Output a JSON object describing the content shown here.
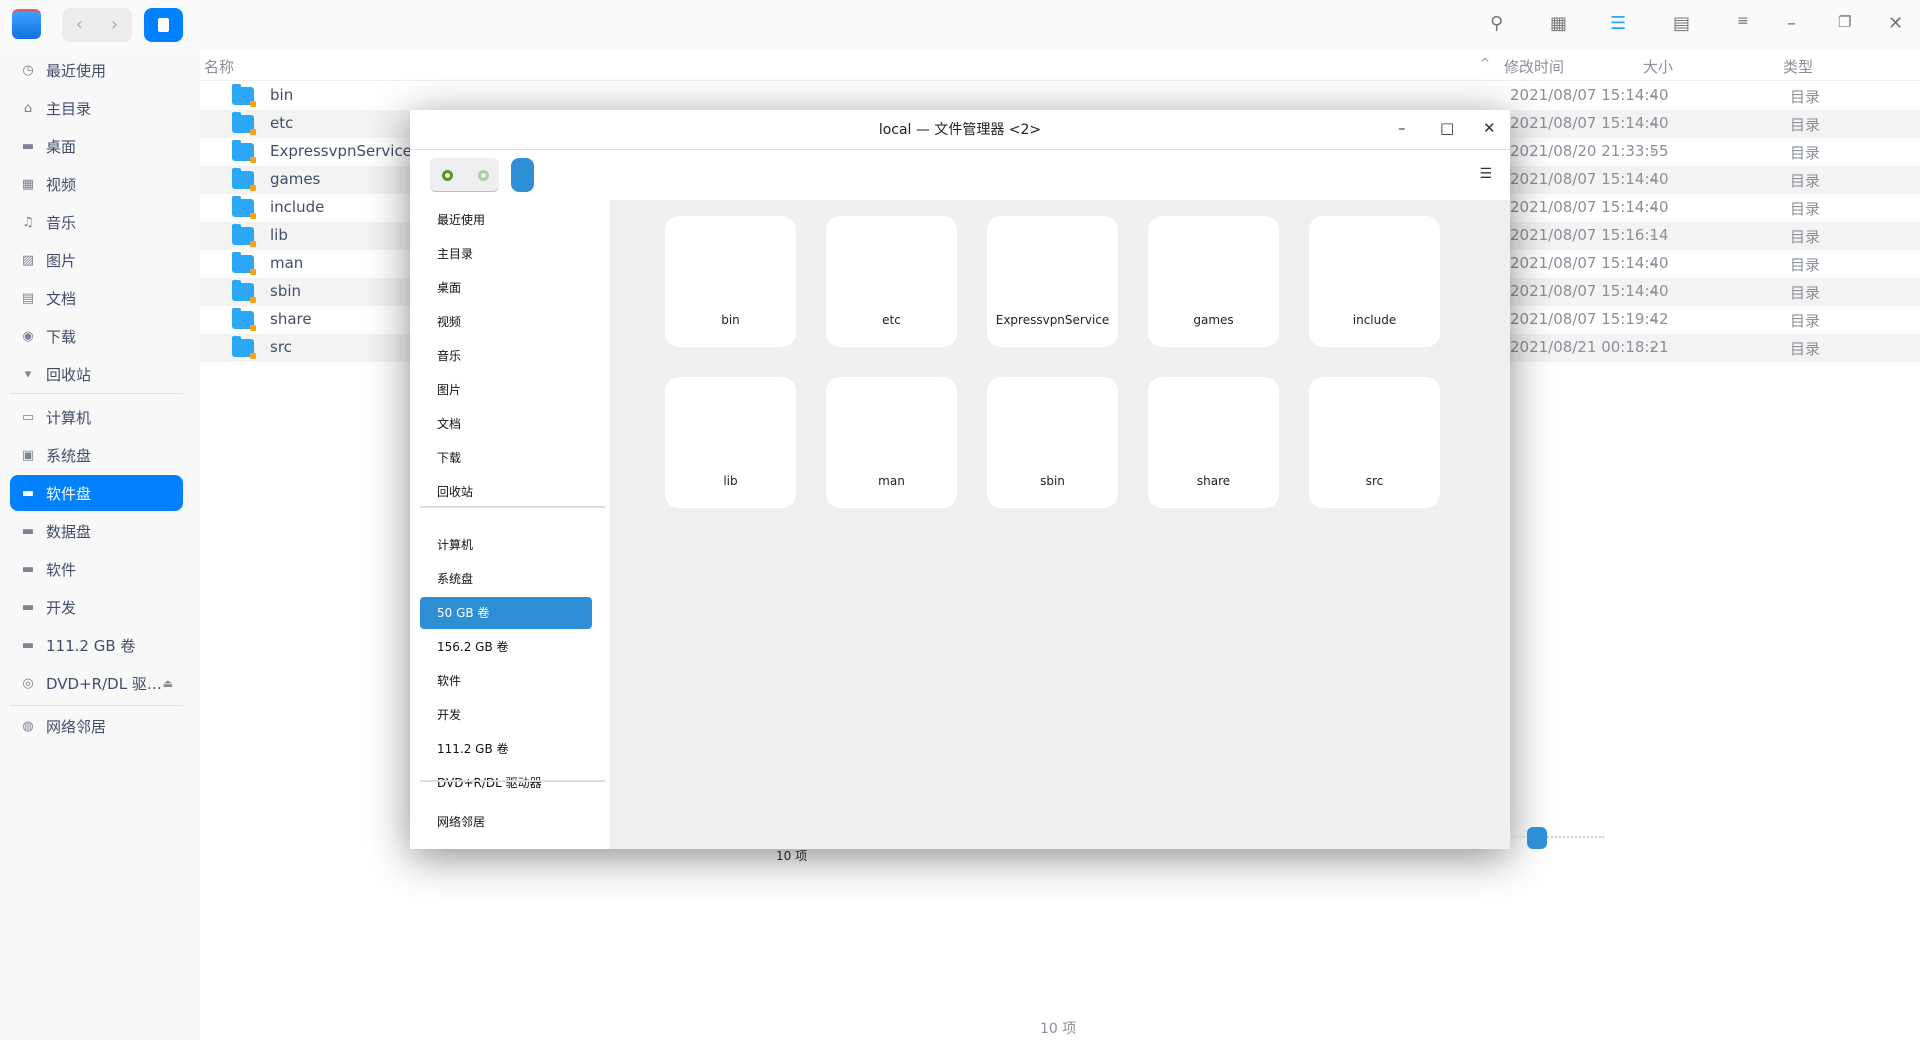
{
  "toolbar": {
    "back": "‹",
    "forward": "›"
  },
  "sidebar": {
    "items": [
      {
        "label": "最近使用",
        "icon": "◷"
      },
      {
        "label": "主目录",
        "icon": "⌂"
      },
      {
        "label": "桌面",
        "icon": "▬"
      },
      {
        "label": "视频",
        "icon": "▦"
      },
      {
        "label": "音乐",
        "icon": "♫"
      },
      {
        "label": "图片",
        "icon": "▨"
      },
      {
        "label": "文档",
        "icon": "▤"
      },
      {
        "label": "下载",
        "icon": "◉"
      },
      {
        "label": "回收站",
        "icon": "▾"
      },
      {
        "label": "计算机",
        "icon": "▭"
      },
      {
        "label": "系统盘",
        "icon": "▣"
      },
      {
        "label": "软件盘",
        "icon": "▬"
      },
      {
        "label": "数据盘",
        "icon": "▬"
      },
      {
        "label": "软件",
        "icon": "▬"
      },
      {
        "label": "开发",
        "icon": "▬"
      },
      {
        "label": "111.2 GB 卷",
        "icon": "▬"
      },
      {
        "label": "DVD+R/DL 驱…",
        "icon": "◎"
      },
      {
        "label": "网络邻居",
        "icon": "◍"
      }
    ],
    "eject": "⏏"
  },
  "columns": {
    "name": "名称",
    "modified": "修改时间",
    "size": "大小",
    "type": "类型"
  },
  "files": [
    {
      "name": "bin",
      "modified": "2021/08/07 15:14:40",
      "size": "-",
      "type": "目录"
    },
    {
      "name": "etc",
      "modified": "2021/08/07 15:14:40",
      "size": "-",
      "type": "目录"
    },
    {
      "name": "ExpressvpnService",
      "modified": "2021/08/20 21:33:55",
      "size": "-",
      "type": "目录"
    },
    {
      "name": "games",
      "modified": "2021/08/07 15:14:40",
      "size": "-",
      "type": "目录"
    },
    {
      "name": "include",
      "modified": "2021/08/07 15:14:40",
      "size": "-",
      "type": "目录"
    },
    {
      "name": "lib",
      "modified": "2021/08/07 15:16:14",
      "size": "-",
      "type": "目录"
    },
    {
      "name": "man",
      "modified": "2021/08/07 15:14:40",
      "size": "-",
      "type": "目录"
    },
    {
      "name": "sbin",
      "modified": "2021/08/07 15:14:40",
      "size": "-",
      "type": "目录"
    },
    {
      "name": "share",
      "modified": "2021/08/07 15:19:42",
      "size": "-",
      "type": "目录"
    },
    {
      "name": "src",
      "modified": "2021/08/21 00:18:21",
      "size": "-",
      "type": "目录"
    }
  ],
  "status": "10 项",
  "dialog": {
    "title": "local — 文件管理器 <2>",
    "sidebar": [
      "最近使用",
      "主目录",
      "桌面",
      "视频",
      "音乐",
      "图片",
      "文档",
      "下载",
      "回收站",
      "计算机",
      "系统盘",
      "50 GB 卷",
      "156.2 GB 卷",
      "软件",
      "开发",
      "111.2 GB 卷",
      "DVD+R/DL 驱动器",
      "网络邻居"
    ],
    "status": "10 项",
    "zoom_level": 0.2
  }
}
